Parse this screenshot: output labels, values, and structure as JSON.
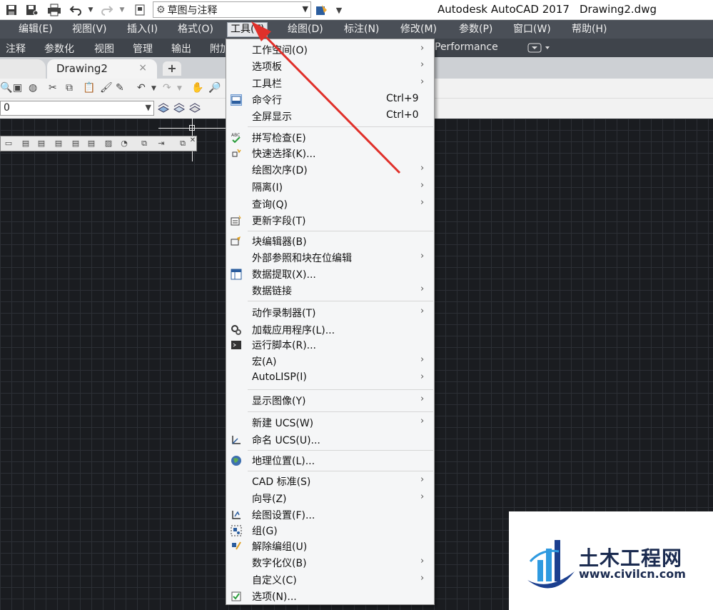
{
  "window": {
    "app_title": "Autodesk AutoCAD 2017",
    "doc_title": "Drawing2.dwg",
    "workspace": "草图与注释"
  },
  "menubar": {
    "items": [
      {
        "label": "编辑(E)"
      },
      {
        "label": "视图(V)"
      },
      {
        "label": "插入(I)"
      },
      {
        "label": "格式(O)"
      },
      {
        "label": "工具(T)",
        "active": true
      },
      {
        "label": "绘图(D)"
      },
      {
        "label": "标注(N)"
      },
      {
        "label": "修改(M)"
      },
      {
        "label": "参数(P)"
      },
      {
        "label": "窗口(W)"
      },
      {
        "label": "帮助(H)"
      }
    ]
  },
  "ribbon": {
    "tabs": [
      "注释",
      "参数化",
      "视图",
      "管理",
      "输出",
      "附加"
    ],
    "extra_tab": "Performance"
  },
  "doc_tabs": {
    "active": "Drawing2",
    "close": "×",
    "add": "+"
  },
  "layer": {
    "current": "0"
  },
  "tools_menu": {
    "items": [
      {
        "label": "工作空间(O)",
        "submenu": true,
        "icon": ""
      },
      {
        "label": "选项板",
        "submenu": true,
        "icon": ""
      },
      {
        "label": "工具栏",
        "submenu": true,
        "icon": ""
      },
      {
        "label": "命令行",
        "shortcut": "Ctrl+9",
        "icon": "command-line-icon"
      },
      {
        "label": "全屏显示",
        "shortcut": "Ctrl+0",
        "icon": ""
      },
      {
        "label": "拼写检查(E)",
        "icon": "spell-check-icon"
      },
      {
        "label": "快速选择(K)...",
        "icon": "quick-select-icon"
      },
      {
        "label": "绘图次序(D)",
        "submenu": true,
        "icon": ""
      },
      {
        "label": "隔离(I)",
        "submenu": true,
        "icon": ""
      },
      {
        "label": "查询(Q)",
        "submenu": true,
        "icon": ""
      },
      {
        "label": "更新字段(T)",
        "icon": "update-field-icon"
      },
      {
        "label": "块编辑器(B)",
        "icon": "block-editor-icon"
      },
      {
        "label": "外部参照和块在位编辑",
        "submenu": true,
        "icon": ""
      },
      {
        "label": "数据提取(X)...",
        "icon": "data-extraction-icon"
      },
      {
        "label": "数据链接",
        "submenu": true,
        "icon": ""
      },
      {
        "label": "动作录制器(T)",
        "submenu": true,
        "icon": ""
      },
      {
        "label": "加载应用程序(L)...",
        "icon": "load-application-icon"
      },
      {
        "label": "运行脚本(R)...",
        "icon": "run-script-icon"
      },
      {
        "label": "宏(A)",
        "submenu": true,
        "icon": ""
      },
      {
        "label": "AutoLISP(I)",
        "submenu": true,
        "icon": ""
      },
      {
        "label": "显示图像(Y)",
        "submenu": true,
        "icon": ""
      },
      {
        "label": "新建 UCS(W)",
        "submenu": true,
        "icon": ""
      },
      {
        "label": "命名 UCS(U)...",
        "icon": "named-ucs-icon"
      },
      {
        "label": "地理位置(L)...",
        "icon": "geo-location-icon"
      },
      {
        "label": "CAD 标准(S)",
        "submenu": true,
        "icon": ""
      },
      {
        "label": "向导(Z)",
        "submenu": true,
        "icon": ""
      },
      {
        "label": "绘图设置(F)...",
        "icon": "drafting-settings-icon"
      },
      {
        "label": "组(G)",
        "icon": "group-icon"
      },
      {
        "label": "解除编组(U)",
        "icon": "ungroup-icon"
      },
      {
        "label": "数字化仪(B)",
        "submenu": true,
        "icon": ""
      },
      {
        "label": "自定义(C)",
        "submenu": true,
        "icon": ""
      },
      {
        "label": "选项(N)...",
        "icon": "options-icon"
      }
    ]
  },
  "watermark": {
    "title": "土木工程网",
    "url": "www.civilcn.com"
  },
  "colors": {
    "menubar_bg": "#4a4f57",
    "ribbon_bg": "#3f444b",
    "canvas_bg": "#1a1c20",
    "annotation_arrow": "#e0302a"
  }
}
